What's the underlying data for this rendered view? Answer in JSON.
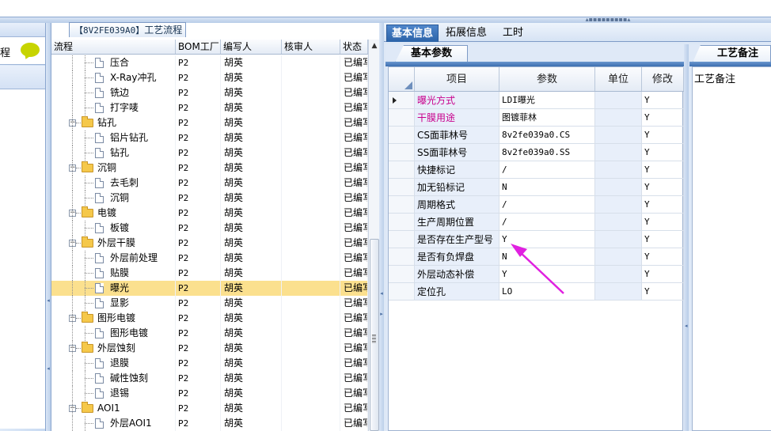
{
  "left_panel": {
    "cut_text": "程"
  },
  "tree": {
    "title_code": "【8V2FE039A0】",
    "title_text": "工艺流程",
    "columns": [
      "流程",
      "BOM工厂",
      "编写人",
      "核审人",
      "状态"
    ],
    "rows": [
      {
        "label": "压合",
        "level": 2,
        "type": "doc",
        "bom": "P2",
        "writer": "胡英",
        "checker": "",
        "status": "已编写"
      },
      {
        "label": "X-Ray冲孔",
        "level": 2,
        "type": "doc",
        "bom": "P2",
        "writer": "胡英",
        "checker": "",
        "status": "已编写"
      },
      {
        "label": "铣边",
        "level": 2,
        "type": "doc",
        "bom": "P2",
        "writer": "胡英",
        "checker": "",
        "status": "已编写"
      },
      {
        "label": "打字唛",
        "level": 2,
        "type": "doc",
        "bom": "P2",
        "writer": "胡英",
        "checker": "",
        "status": "已编写"
      },
      {
        "label": "钻孔",
        "level": 1,
        "type": "folder",
        "bom": "P2",
        "writer": "胡英",
        "checker": "",
        "status": "已编写"
      },
      {
        "label": "铝片钻孔",
        "level": 2,
        "type": "doc",
        "bom": "P2",
        "writer": "胡英",
        "checker": "",
        "status": "已编写"
      },
      {
        "label": "钻孔",
        "level": 2,
        "type": "doc",
        "bom": "P2",
        "writer": "胡英",
        "checker": "",
        "status": "已编写"
      },
      {
        "label": "沉铜",
        "level": 1,
        "type": "folder",
        "bom": "P2",
        "writer": "胡英",
        "checker": "",
        "status": "已编写"
      },
      {
        "label": "去毛刺",
        "level": 2,
        "type": "doc",
        "bom": "P2",
        "writer": "胡英",
        "checker": "",
        "status": "已编写"
      },
      {
        "label": "沉铜",
        "level": 2,
        "type": "doc",
        "bom": "P2",
        "writer": "胡英",
        "checker": "",
        "status": "已编写"
      },
      {
        "label": "电镀",
        "level": 1,
        "type": "folder",
        "bom": "P2",
        "writer": "胡英",
        "checker": "",
        "status": "已编写"
      },
      {
        "label": "板镀",
        "level": 2,
        "type": "doc",
        "bom": "P2",
        "writer": "胡英",
        "checker": "",
        "status": "已编写"
      },
      {
        "label": "外层干膜",
        "level": 1,
        "type": "folder",
        "bom": "P2",
        "writer": "胡英",
        "checker": "",
        "status": "已编写"
      },
      {
        "label": "外层前处理",
        "level": 2,
        "type": "doc",
        "bom": "P2",
        "writer": "胡英",
        "checker": "",
        "status": "已编写"
      },
      {
        "label": "贴膜",
        "level": 2,
        "type": "doc",
        "bom": "P2",
        "writer": "胡英",
        "checker": "",
        "status": "已编写"
      },
      {
        "label": "曝光",
        "level": 2,
        "type": "doc",
        "bom": "P2",
        "writer": "胡英",
        "checker": "",
        "status": "已编写",
        "selected": true
      },
      {
        "label": "显影",
        "level": 2,
        "type": "doc",
        "bom": "P2",
        "writer": "胡英",
        "checker": "",
        "status": "已编写"
      },
      {
        "label": "图形电镀",
        "level": 1,
        "type": "folder",
        "bom": "P2",
        "writer": "胡英",
        "checker": "",
        "status": "已编写"
      },
      {
        "label": "图形电镀",
        "level": 2,
        "type": "doc",
        "bom": "P2",
        "writer": "胡英",
        "checker": "",
        "status": "已编写"
      },
      {
        "label": "外层蚀刻",
        "level": 1,
        "type": "folder",
        "bom": "P2",
        "writer": "胡英",
        "checker": "",
        "status": "已编写"
      },
      {
        "label": "退膜",
        "level": 2,
        "type": "doc",
        "bom": "P2",
        "writer": "胡英",
        "checker": "",
        "status": "已编写"
      },
      {
        "label": "碱性蚀刻",
        "level": 2,
        "type": "doc",
        "bom": "P2",
        "writer": "胡英",
        "checker": "",
        "status": "已编写"
      },
      {
        "label": "退锡",
        "level": 2,
        "type": "doc",
        "bom": "P2",
        "writer": "胡英",
        "checker": "",
        "status": "已编写"
      },
      {
        "label": "AOI1",
        "level": 1,
        "type": "folder",
        "bom": "P2",
        "writer": "胡英",
        "checker": "",
        "status": "已编写"
      },
      {
        "label": "外层AOI1",
        "level": 2,
        "type": "doc",
        "bom": "P2",
        "writer": "胡英",
        "checker": "",
        "status": "已编写"
      }
    ],
    "toggle_symbol": "−"
  },
  "tabs": [
    {
      "label": "基本信息",
      "active": true
    },
    {
      "label": "拓展信息",
      "active": false
    },
    {
      "label": "工时",
      "active": false
    }
  ],
  "params": {
    "subtab": "基本参数",
    "columns": [
      "项目",
      "参数",
      "单位",
      "修改"
    ],
    "rows": [
      {
        "item": "曝光方式",
        "param": "LDI曝光",
        "unit": "",
        "mod": "Y",
        "pink": true,
        "current": true
      },
      {
        "item": "干膜用途",
        "param": "图镀菲林",
        "unit": "",
        "mod": "Y",
        "pink": true
      },
      {
        "item": "CS面菲林号",
        "param": "8v2fe039a0.CS",
        "unit": "",
        "mod": "Y"
      },
      {
        "item": "SS面菲林号",
        "param": "8v2fe039a0.SS",
        "unit": "",
        "mod": "Y"
      },
      {
        "item": "快捷标记",
        "param": "/",
        "unit": "",
        "mod": "Y"
      },
      {
        "item": "加无铅标记",
        "param": "N",
        "unit": "",
        "mod": "Y"
      },
      {
        "item": "周期格式",
        "param": "/",
        "unit": "",
        "mod": "Y"
      },
      {
        "item": "生产周期位置",
        "param": "/",
        "unit": "",
        "mod": "Y"
      },
      {
        "item": "是否存在生产型号",
        "param": "Y",
        "unit": "",
        "mod": "Y"
      },
      {
        "item": "是否有负焊盘",
        "param": "N",
        "unit": "",
        "mod": "Y"
      },
      {
        "item": "外层动态补偿",
        "param": "Y",
        "unit": "",
        "mod": "Y"
      },
      {
        "item": "定位孔",
        "param": "LO",
        "unit": "",
        "mod": "Y"
      }
    ]
  },
  "notes": {
    "tab": "工艺备注",
    "label": "工艺备注"
  },
  "colors": {
    "accent_tab": "#2c63a8",
    "selected_row": "#fbe08e",
    "annotation_arrow": "#e020e0",
    "pink_text": "#c8008c"
  }
}
